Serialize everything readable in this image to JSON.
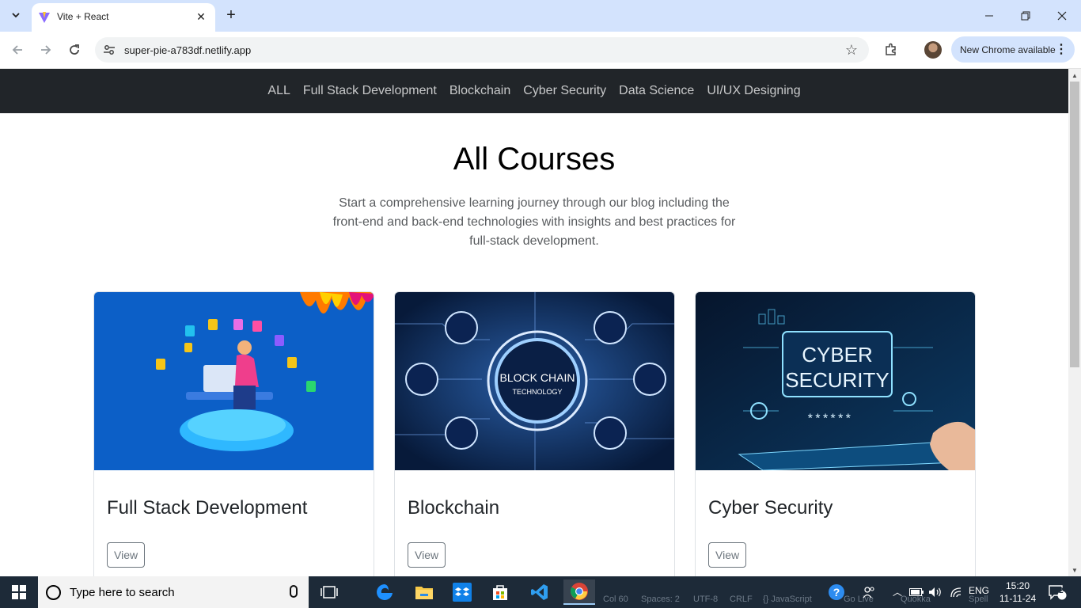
{
  "browser": {
    "tab_title": "Vite + React",
    "url": "super-pie-a783df.netlify.app",
    "update_label": "New Chrome available"
  },
  "nav": {
    "links": [
      "ALL",
      "Full Stack Development",
      "Blockchain",
      "Cyber Security",
      "Data Science",
      "UI/UX Designing"
    ]
  },
  "hero": {
    "title": "All Courses",
    "description": "Start a comprehensive learning journey through our blog including the front-end and back-end technologies with insights and best practices for full-stack development."
  },
  "courses": [
    {
      "title": "Full Stack Development",
      "button": "View",
      "image_text": ""
    },
    {
      "title": "Blockchain",
      "button": "View",
      "image_text": "BLOCK CHAIN",
      "image_subtext": "TECHNOLOGY"
    },
    {
      "title": "Cyber Security",
      "button": "View",
      "image_text": "CYBER",
      "image_subtext": "SECURITY",
      "image_stars": "******"
    }
  ],
  "taskbar": {
    "search_placeholder": "Type here to search",
    "lang": "ENG",
    "time": "15:20",
    "date": "11-11-24",
    "notifications": "2",
    "status_ghost": [
      "Col 60",
      "Spaces: 2",
      "UTF-8",
      "CRLF",
      "{} JavaScript",
      "Go Live",
      "Quokka",
      "Spell"
    ]
  },
  "colors": {
    "navbar_bg": "#212529",
    "tab_strip": "#d3e3fd",
    "taskbar": "#1d2a38"
  }
}
